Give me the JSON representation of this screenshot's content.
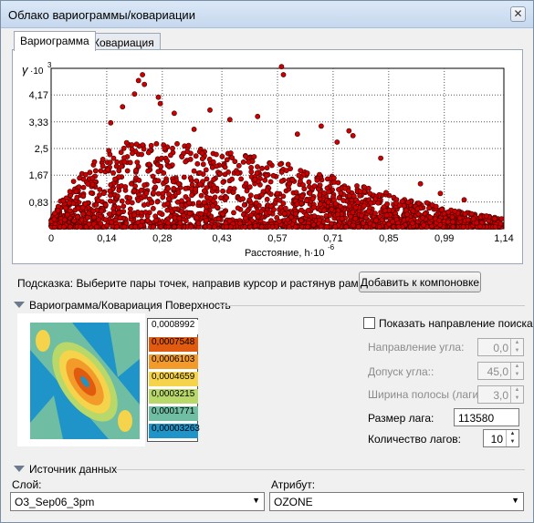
{
  "window": {
    "title": "Облако вариограммы/ковариации",
    "close_glyph": "✕"
  },
  "tabs": [
    {
      "label": "Вариограмма",
      "active": true
    },
    {
      "label": "Ковариация",
      "active": false
    }
  ],
  "chart_data": {
    "type": "scatter",
    "y_symbol": "γ",
    "y_multiplier": "·10",
    "y_exponent": "3",
    "xlabel": "Расстояние, h·10",
    "x_exponent": "-6",
    "xticks": [
      "0",
      "0,14",
      "0,28",
      "0,43",
      "0,57",
      "0,71",
      "0,85",
      "0,99",
      "1,14"
    ],
    "yticks": [
      "0,83",
      "1,67",
      "2,5",
      "3,33",
      "4,17"
    ],
    "xlim": [
      0,
      1.14
    ],
    "ylim": [
      0,
      5.0
    ],
    "grid": true,
    "marker_color": "#cc0000",
    "marker_edge": "#3a0000",
    "envelope": {
      "x": [
        0,
        0.02,
        0.05,
        0.1,
        0.15,
        0.2,
        0.25,
        0.3,
        0.35,
        0.4,
        0.45,
        0.5,
        0.55,
        0.6,
        0.65,
        0.7,
        0.75,
        0.8,
        0.85,
        0.9,
        0.95,
        1.0,
        1.05,
        1.1,
        1.14
      ],
      "y": [
        0.3,
        0.8,
        1.4,
        2.0,
        2.5,
        2.8,
        2.8,
        2.7,
        2.6,
        2.5,
        2.4,
        2.3,
        2.2,
        2.0,
        1.8,
        1.7,
        1.5,
        1.3,
        1.1,
        0.9,
        0.8,
        0.6,
        0.5,
        0.4,
        0.3
      ]
    },
    "outliers": [
      {
        "x": 0.23,
        "y": 4.8
      },
      {
        "x": 0.22,
        "y": 4.62
      },
      {
        "x": 0.235,
        "y": 4.5
      },
      {
        "x": 0.27,
        "y": 4.1
      },
      {
        "x": 0.275,
        "y": 3.9
      },
      {
        "x": 0.21,
        "y": 4.2
      },
      {
        "x": 0.58,
        "y": 5.05
      },
      {
        "x": 0.585,
        "y": 4.8
      },
      {
        "x": 0.31,
        "y": 3.6
      },
      {
        "x": 0.45,
        "y": 3.4
      },
      {
        "x": 0.52,
        "y": 3.5
      },
      {
        "x": 0.75,
        "y": 3.05
      },
      {
        "x": 0.76,
        "y": 2.9
      },
      {
        "x": 0.72,
        "y": 2.7
      },
      {
        "x": 0.83,
        "y": 2.2
      },
      {
        "x": 0.15,
        "y": 3.3
      },
      {
        "x": 0.18,
        "y": 3.8
      },
      {
        "x": 0.36,
        "y": 3.1
      },
      {
        "x": 0.62,
        "y": 2.95
      },
      {
        "x": 0.68,
        "y": 3.2
      },
      {
        "x": 0.93,
        "y": 1.4
      },
      {
        "x": 0.98,
        "y": 1.1
      },
      {
        "x": 1.04,
        "y": 0.9
      },
      {
        "x": 0.4,
        "y": 3.7
      }
    ]
  },
  "hint": "Подсказка: Выберите пары точек, направив курсор и растянув рамку",
  "add_button": "Добавить к компоновке",
  "surface_section": {
    "title": "Вариограмма/Ковариация Поверхность"
  },
  "legend": [
    {
      "label": "0,0008992",
      "color": "#ffffff"
    },
    {
      "label": "0,0007548",
      "color": "#e05a0f"
    },
    {
      "label": "0,0006103",
      "color": "#f29b2b"
    },
    {
      "label": "0,0004659",
      "color": "#f5d34a"
    },
    {
      "label": "0,0003215",
      "color": "#b8d86a"
    },
    {
      "label": "0,0001771",
      "color": "#6fbda3"
    },
    {
      "label": "0,00003263",
      "color": "#1e94c8"
    }
  ],
  "search": {
    "show_direction_label": "Показать направление поиска",
    "angle_dir_label": "Направление угла:",
    "angle_dir_value": "0,0",
    "angle_tol_label": "Допуск угла::",
    "angle_tol_value": "45,0",
    "bandwidth_label": "Ширина полосы (лаги):",
    "bandwidth_value": "3,0",
    "lag_size_label": "Размер лага:",
    "lag_size_value": "113580",
    "lag_count_label": "Количество лагов:",
    "lag_count_value": "10"
  },
  "source_section": {
    "title": "Источник данных"
  },
  "layer": {
    "label": "Слой:",
    "value": "O3_Sep06_3pm"
  },
  "attribute": {
    "label": "Атрибут:",
    "value": "OZONE"
  }
}
